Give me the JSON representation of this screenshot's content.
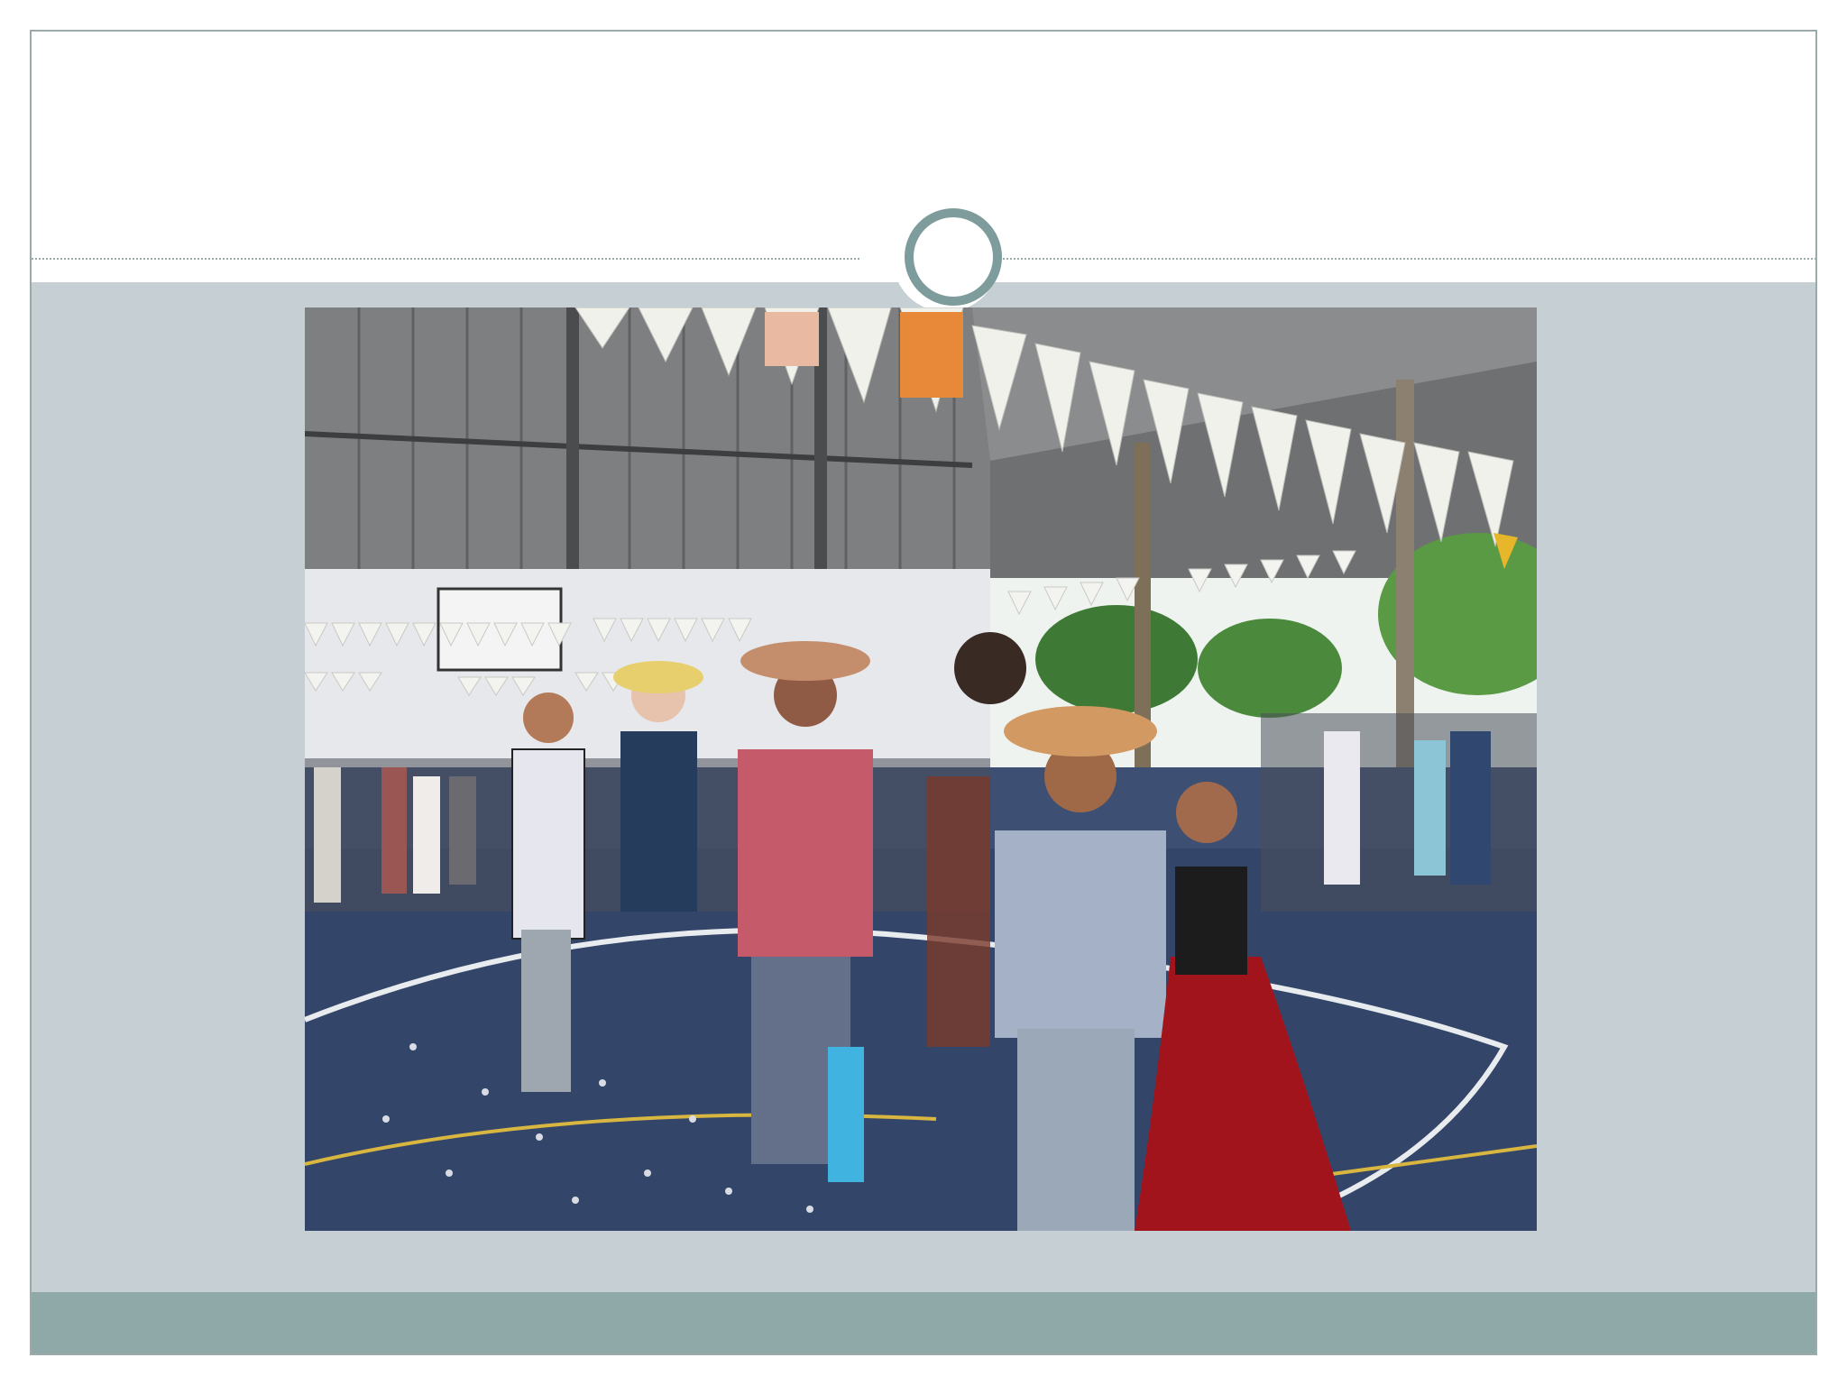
{
  "slide": {
    "title": "",
    "image": {
      "description_icon": "photo-icon",
      "alt": ""
    },
    "theme": {
      "content_background": "#c6d0d4",
      "footer_background": "#8fa9a9",
      "ring_color": "#7e9c9c",
      "rule_color": "#9aa9aa",
      "title_background": "#ffffff"
    }
  }
}
